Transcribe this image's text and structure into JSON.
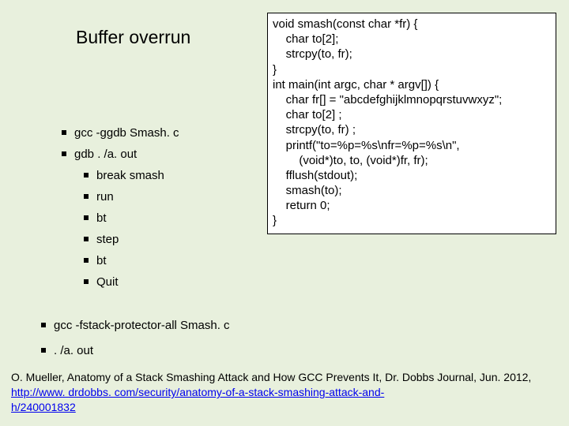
{
  "title": "Buffer overrun",
  "left": {
    "i0": "gcc -ggdb Smash. c",
    "i1": "gdb . /a. out",
    "s0": "break smash",
    "s1": "run",
    "s2": "bt",
    "s3": "step",
    "s4": "bt",
    "s5": "Quit"
  },
  "rows": {
    "r0": "gcc -fstack-protector-all Smash. c",
    "r1": ". /a. out"
  },
  "code": {
    "l0": "void smash(const char *fr) {",
    "l1": "    char to[2];",
    "l2": "    strcpy(to, fr);",
    "l3": "}",
    "l4": "int main(int argc, char * argv[]) {",
    "l5": "    char fr[] = \"abcdefghijklmnopqrstuvwxyz\";",
    "l6": "    char to[2] ;",
    "l7": "    strcpy(to, fr) ;",
    "l8": "    printf(\"to=%p=%s\\nfr=%p=%s\\n\",",
    "l9": "        (void*)to, to, (void*)fr, fr);",
    "l10": "    fflush(stdout);",
    "l11": "    smash(to);",
    "l12": "    return 0;",
    "l13": "}"
  },
  "footer": {
    "pre": "O. Mueller, Anatomy of a Stack Smashing Attack and How GCC Prevents It, Dr. Dobbs Journal, Jun. 2012, ",
    "url1": "http://www. drdobbs. com/security/anatomy-of-a-stack-smashing-attack-and-",
    "url2": "h/240001832"
  }
}
